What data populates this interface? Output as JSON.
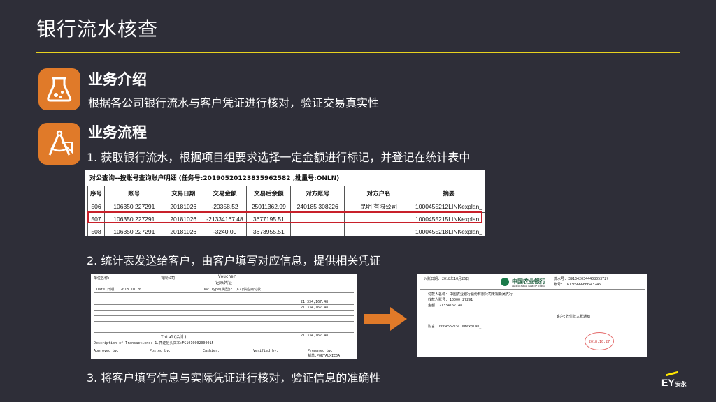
{
  "title": "银行流水核查",
  "sections": {
    "intro": {
      "heading": "业务介绍",
      "text": "根据各公司银行流水与客户凭证进行核对，验证交易真实性"
    },
    "process": {
      "heading": "业务流程",
      "step1": "1. 获取银行流水，根据项目组要求选择一定金额进行标记，并登记在统计表中",
      "step2": "2. 统计表发送给客户，由客户填写对应信息，提供相关凭证",
      "step3": "3. 将客户填写信息与实际凭证进行核对，验证信息的准确性"
    }
  },
  "bank_statement": {
    "caption": "对公查询--按账号查询账户明细 (任务号:20190520123835962582 ,批量号:ONLN)",
    "headers": [
      "序号",
      "账号",
      "交易日期",
      "交易金额",
      "交易后余额",
      "对方账号",
      "对方户名",
      "摘要"
    ],
    "rows": [
      {
        "no": "506",
        "account": "106350        227291",
        "date": "20181026",
        "amount": "-20358.52",
        "balance": "25011362.99",
        "counter_account": "240185        308226",
        "counter_name": "昆明                有限公司",
        "memo": "1000455212LINKexplan_"
      },
      {
        "no": "507",
        "account": "106350        227291",
        "date": "20181026",
        "amount": "-21334167.48",
        "balance": "3677195.51",
        "counter_account": "",
        "counter_name": "",
        "memo": "1000455215LINKexplan_"
      },
      {
        "no": "508",
        "account": "106350        227291",
        "date": "20181026",
        "amount": "-3240.00",
        "balance": "3673955.51",
        "counter_account": "",
        "counter_name": "",
        "memo": "1000455218LINKexplan_"
      }
    ]
  },
  "voucher": {
    "unit": "单位名称:",
    "company": "有限公司",
    "title_en": "Voucher",
    "title_cn": "记账凭证",
    "date": "Date(日期): 2018.10.26",
    "doc_type": "Doc Type(类型): (KZ)供应商付款",
    "total": "Total(合计)",
    "amount": "21,334,167.48",
    "description": "Description of Transactions: 1.凭证抬头文本:FG1010002000015",
    "approved": "Approved by:",
    "posted": "Posted by:",
    "cashier": "Cashier:",
    "verified": "Verified by:",
    "prepared": "Prepared by:",
    "prepared_name": "制单:PORTALXIE5A"
  },
  "receipt": {
    "bank_name": "中国农业银行",
    "bank_name_en": "AGRICULTURAL BANK OF CHINA",
    "date": "入账日期: 2018年10月26日",
    "serial": "流水号: 391342034440805372?",
    "account": "账号: 16130999999543246",
    "payer": "付款人名称: 中国农业银行股份有限公司无锡新吴支行",
    "payee": "收款人账号: 10000        27291",
    "amount": "金额: 21334167.48",
    "memo": "附言:1000455215LINKexplan_",
    "customer": "客户:收付款入账通知",
    "stamp": "2018.10.27"
  },
  "colors": {
    "background": "#2e2e38",
    "accent": "#e8d21f",
    "icon": "#e07a29",
    "highlight": "#c8202a"
  },
  "icons": {
    "intro": "chemistry-flask-icon",
    "process": "compass-ruler-icon",
    "arrow": "right-arrow-icon"
  },
  "logo": {
    "text": "EY",
    "cn": "安永"
  }
}
